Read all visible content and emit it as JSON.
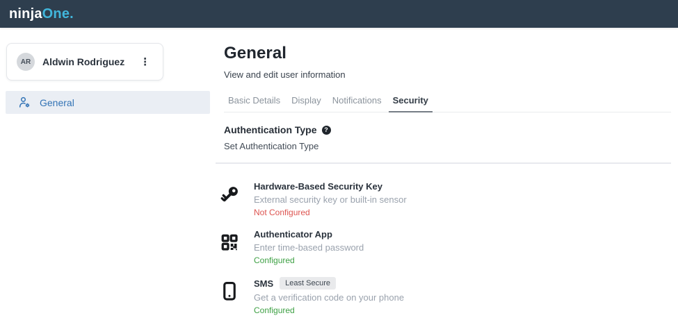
{
  "header": {
    "logo": {
      "part1": "ninja",
      "part2": "One",
      "dot": "."
    }
  },
  "sidebar": {
    "user": {
      "initials": "AR",
      "name": "Aldwin Rodriguez"
    },
    "items": [
      {
        "label": "General",
        "icon": "user-gear-icon",
        "active": true
      }
    ]
  },
  "main": {
    "title": "General",
    "subtitle": "View and edit user information",
    "tabs": [
      {
        "label": "Basic Details",
        "active": false
      },
      {
        "label": "Display",
        "active": false
      },
      {
        "label": "Notifications",
        "active": false
      },
      {
        "label": "Security",
        "active": true
      }
    ],
    "section": {
      "heading": "Authentication Type",
      "help_icon": "?",
      "description": "Set Authentication Type",
      "methods": [
        {
          "icon": "key-icon",
          "title": "Hardware-Based Security Key",
          "description": "External security key or built-in sensor",
          "status": "Not Configured",
          "status_color": "#dd5450"
        },
        {
          "icon": "qr-code-icon",
          "title": "Authenticator App",
          "description": "Enter time-based password",
          "status": "Configured",
          "status_color": "#3ea044"
        },
        {
          "icon": "smartphone-icon",
          "title": "SMS",
          "badge": "Least Secure",
          "description": "Get a verification code on your phone",
          "status": "Configured",
          "status_color": "#3ea044"
        }
      ]
    }
  },
  "colors": {
    "header_bg": "#2e3e4e",
    "logo_accent": "#41b6dc",
    "primary_blue": "#3273b5",
    "active_item_bg": "#eaeef4",
    "status_error": "#dd5450",
    "status_success": "#3ea044",
    "badge_bg": "#e9eaec"
  }
}
